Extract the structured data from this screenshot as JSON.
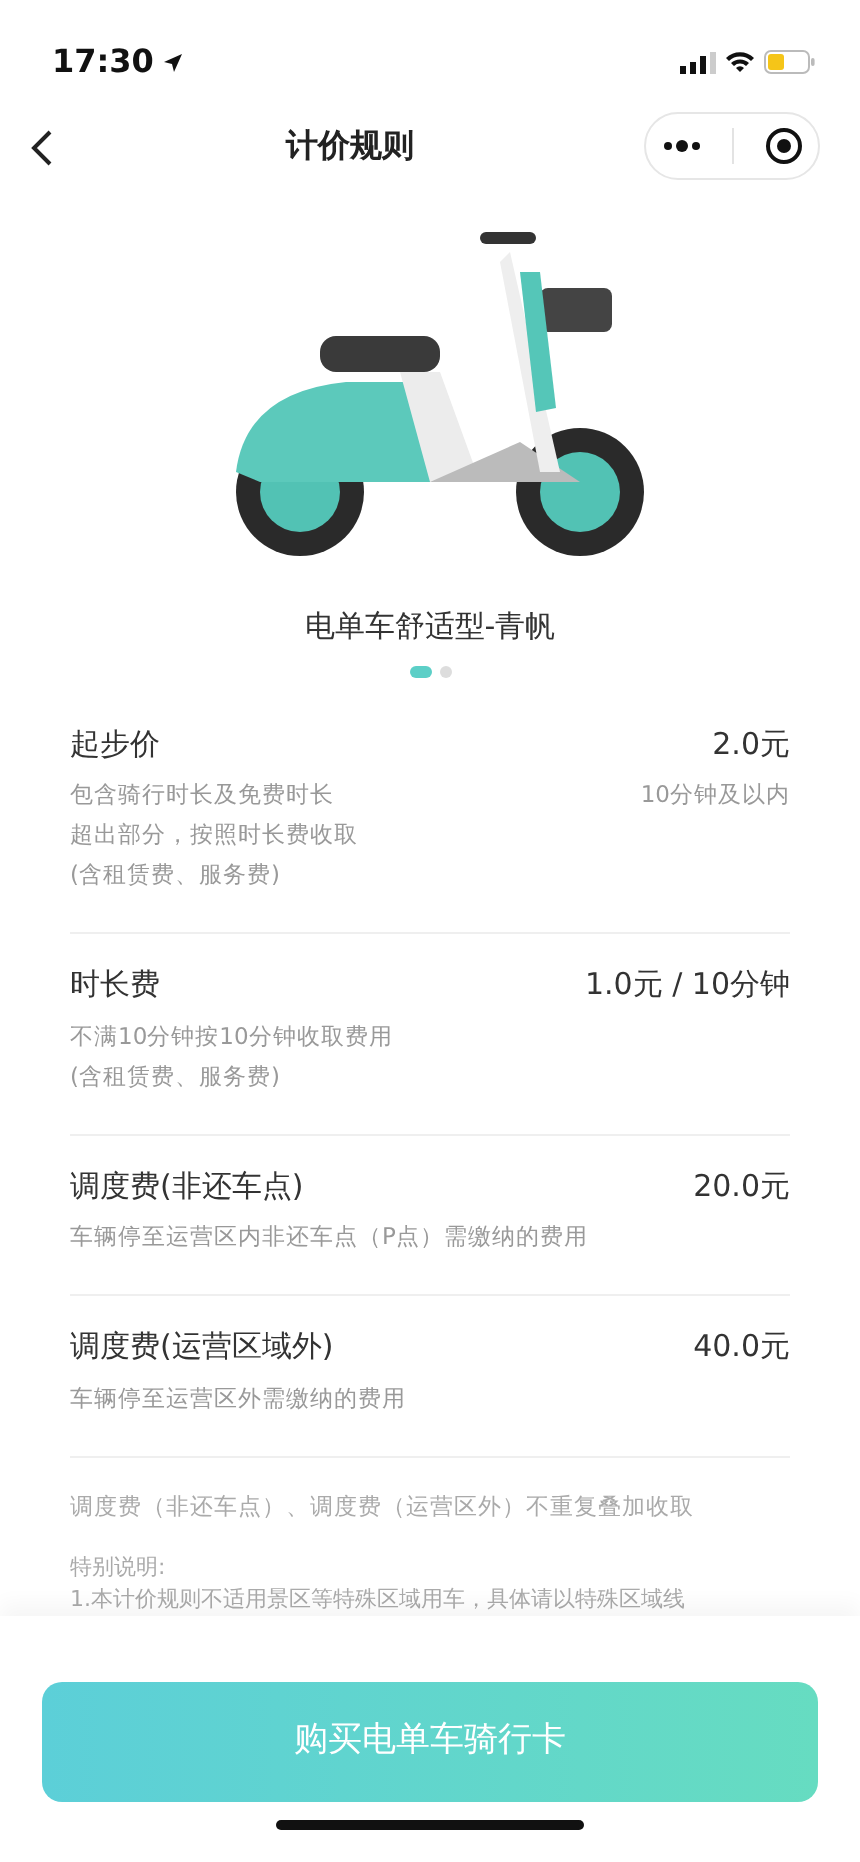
{
  "status_bar": {
    "time": "17:30"
  },
  "nav": {
    "title": "计价规则"
  },
  "product": {
    "kind": "picture",
    "name": "电单车舒适型-青帆",
    "slides": [
      {
        "selected": true
      },
      {
        "selected": false
      }
    ]
  },
  "fees": [
    {
      "name": "起步价",
      "price": "2.0元",
      "lines": [
        "包含骑行时长及免费时长",
        "超出部分，按照时长费收取",
        "(含租赁费、服务费)"
      ],
      "aside": "10分钟及以内"
    },
    {
      "name": "时长费",
      "price": "1.0元 / 10分钟",
      "lines": [
        "不满10分钟按10分钟收取费用",
        "(含租赁费、服务费)"
      ]
    },
    {
      "name": "调度费(非还车点)",
      "price": "20.0元",
      "lines": [
        "车辆停至运营区内非还车点（P点）需缴纳的费用"
      ]
    },
    {
      "name": "调度费(运营区域外)",
      "price": "40.0元",
      "lines": [
        "车辆停至运营区外需缴纳的费用"
      ]
    }
  ],
  "note": "调度费（非还车点）、调度费（运营区外）不重复叠加收取",
  "special": {
    "title": "特别说明:",
    "text": "1.本计价规则不适用景区等特殊区域用车，具体请以特殊区域线"
  },
  "buy_button": "购买电单车骑行卡"
}
